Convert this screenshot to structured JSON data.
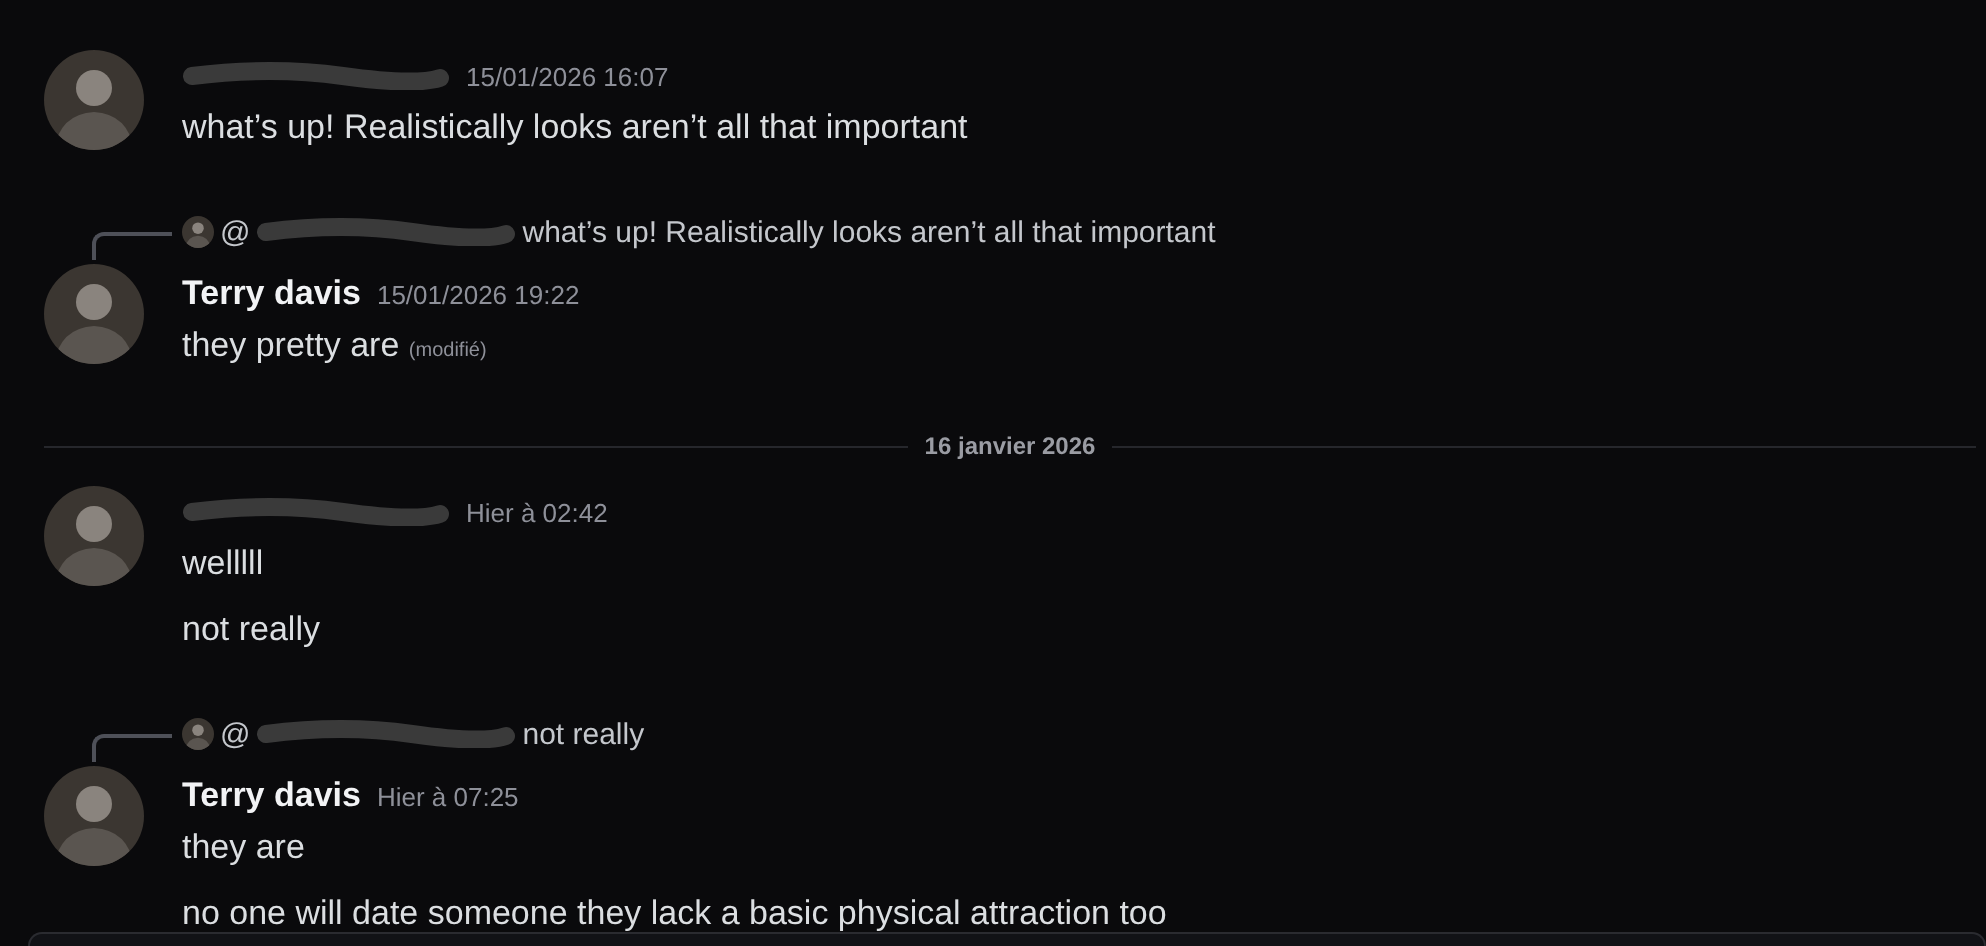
{
  "messages": [
    {
      "kind": "message",
      "author_redacted": true,
      "timestamp": "15/01/2026 16:07",
      "lines": [
        {
          "text": "what’s up! Realistically looks aren’t all that important"
        }
      ]
    },
    {
      "kind": "message",
      "reply": {
        "prefix": "@",
        "mention_redacted": true,
        "text": "what’s up! Realistically looks aren’t all that important"
      },
      "author": "Terry davis",
      "author_redacted": false,
      "timestamp": "15/01/2026 19:22",
      "lines": [
        {
          "text": "they pretty are",
          "edited": "(modifié)"
        }
      ]
    },
    {
      "kind": "divider",
      "label": "16 janvier 2026"
    },
    {
      "kind": "message",
      "author_redacted": true,
      "timestamp": "Hier à 02:42",
      "lines": [
        {
          "text": "welllll"
        },
        {
          "text": "not really"
        }
      ]
    },
    {
      "kind": "message",
      "reply": {
        "prefix": "@",
        "mention_redacted": true,
        "text": "not really"
      },
      "author": "Terry davis",
      "author_redacted": false,
      "timestamp": "Hier à 07:25",
      "lines": [
        {
          "text": "they are"
        },
        {
          "text": "no one will date someone they lack a basic physical attraction too"
        }
      ]
    }
  ]
}
